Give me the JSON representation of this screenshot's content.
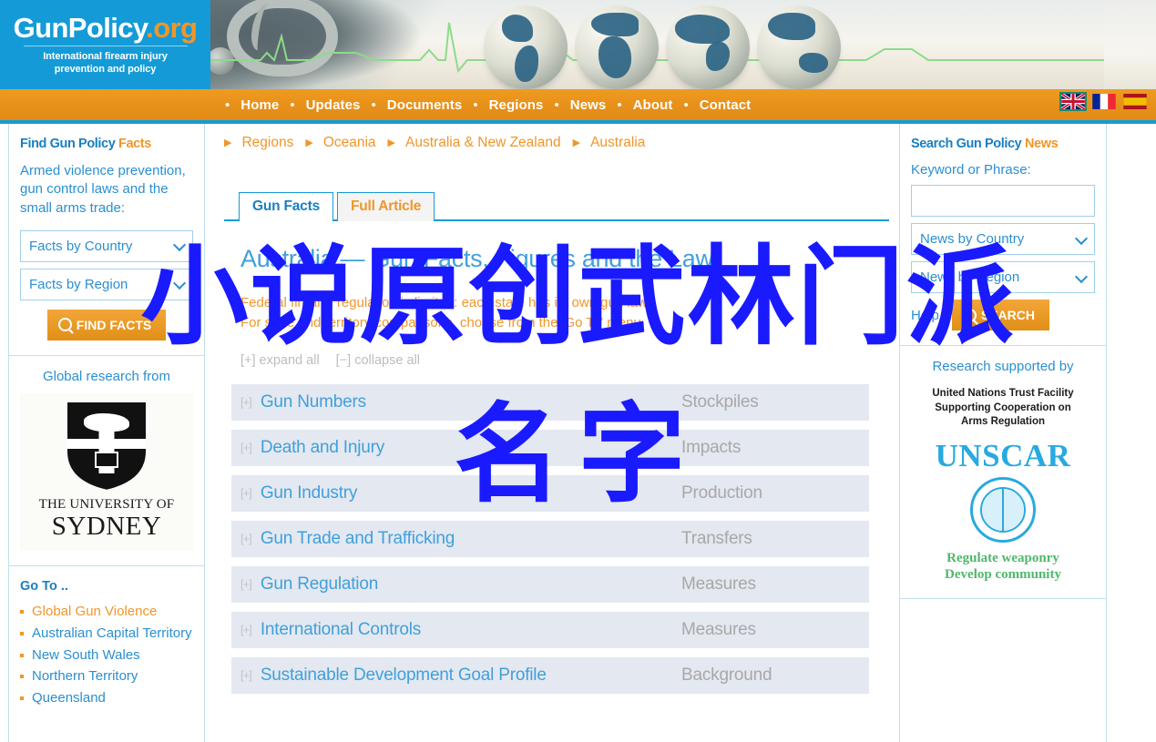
{
  "site": {
    "logo_main": "GunPolicy",
    "logo_dot": ".org",
    "logo_sub_line1": "International firearm injury",
    "logo_sub_line2": "prevention and policy",
    "brand_blue": "#149bd7",
    "brand_orange": "#f0962a"
  },
  "nav": {
    "items": [
      {
        "label": "Home"
      },
      {
        "label": "Updates"
      },
      {
        "label": "Documents"
      },
      {
        "label": "Regions"
      },
      {
        "label": "News"
      },
      {
        "label": "About"
      },
      {
        "label": "Contact"
      }
    ],
    "separator": "•",
    "flags": [
      {
        "name": "flag-uk",
        "active": true
      },
      {
        "name": "flag-france",
        "active": false
      },
      {
        "name": "flag-spain",
        "active": false
      }
    ]
  },
  "left_sidebar": {
    "find_facts": {
      "title_main": "Find Gun Policy ",
      "title_accent": "Facts",
      "description": "Armed violence prevention, gun control laws and the small arms trade:",
      "select_country": "Facts by Country",
      "select_region": "Facts by Region",
      "button": "FIND FACTS"
    },
    "research": {
      "heading": "Global research from",
      "university_line1": "THE UNIVERSITY OF",
      "university_line2": "SYDNEY"
    },
    "goto": {
      "title": "Go To ..",
      "items": [
        {
          "label": "Global Gun Violence",
          "highlight": true
        },
        {
          "label": "Australian Capital Territory",
          "highlight": false
        },
        {
          "label": "New South Wales",
          "highlight": false
        },
        {
          "label": "Northern Territory",
          "highlight": false
        },
        {
          "label": "Queensland",
          "highlight": false
        }
      ]
    }
  },
  "right_sidebar": {
    "search": {
      "title_main": "Search Gun Policy ",
      "title_accent": "News",
      "keyword_label": "Keyword or Phrase:",
      "keyword_value": "",
      "keyword_placeholder": "",
      "select_country": "News by Country",
      "select_region": "News by Region",
      "help_label": "Help",
      "button": "SEARCH"
    },
    "supporter": {
      "heading": "Research supported by",
      "caption_line1": "United Nations Trust Facility",
      "caption_line2": "Supporting Cooperation on",
      "caption_line3": "Arms Regulation",
      "wordmark": "UNSCAR",
      "tagline_line1": "Regulate weaponry",
      "tagline_line2": "Develop community"
    }
  },
  "main": {
    "breadcrumb": [
      "Regions",
      "Oceania",
      "Australia & New Zealand",
      "Australia"
    ],
    "breadcrumb_arrow": "▶",
    "tabs": [
      {
        "label": "Gun Facts",
        "active": true
      },
      {
        "label": "Full Article",
        "active": false
      }
    ],
    "page_title": "Australia — Gun Facts, Figures and the Law",
    "intro_line1": "Federal firearm regulation is limited: each state has its own gun law.",
    "intro_line2": "For state and territory comparisons, choose from the 'Go To' menu.",
    "expand_all": "[+] expand all",
    "collapse_all": "[−] collapse all",
    "facts": [
      {
        "toggle": "[+]",
        "label": "Gun Numbers",
        "category": "Stockpiles"
      },
      {
        "toggle": "[+]",
        "label": "Death and Injury",
        "category": "Impacts"
      },
      {
        "toggle": "[+]",
        "label": "Gun Industry",
        "category": "Production"
      },
      {
        "toggle": "[+]",
        "label": "Gun Trade and Trafficking",
        "category": "Transfers"
      },
      {
        "toggle": "[+]",
        "label": "Gun Regulation",
        "category": "Measures"
      },
      {
        "toggle": "[+]",
        "label": "International Controls",
        "category": "Measures"
      },
      {
        "toggle": "[+]",
        "label": "Sustainable Development Goal Profile",
        "category": "Background"
      }
    ]
  },
  "overlay": {
    "line1": "小说原创武林门派",
    "line2": "名字",
    "color": "#1a1aff"
  }
}
